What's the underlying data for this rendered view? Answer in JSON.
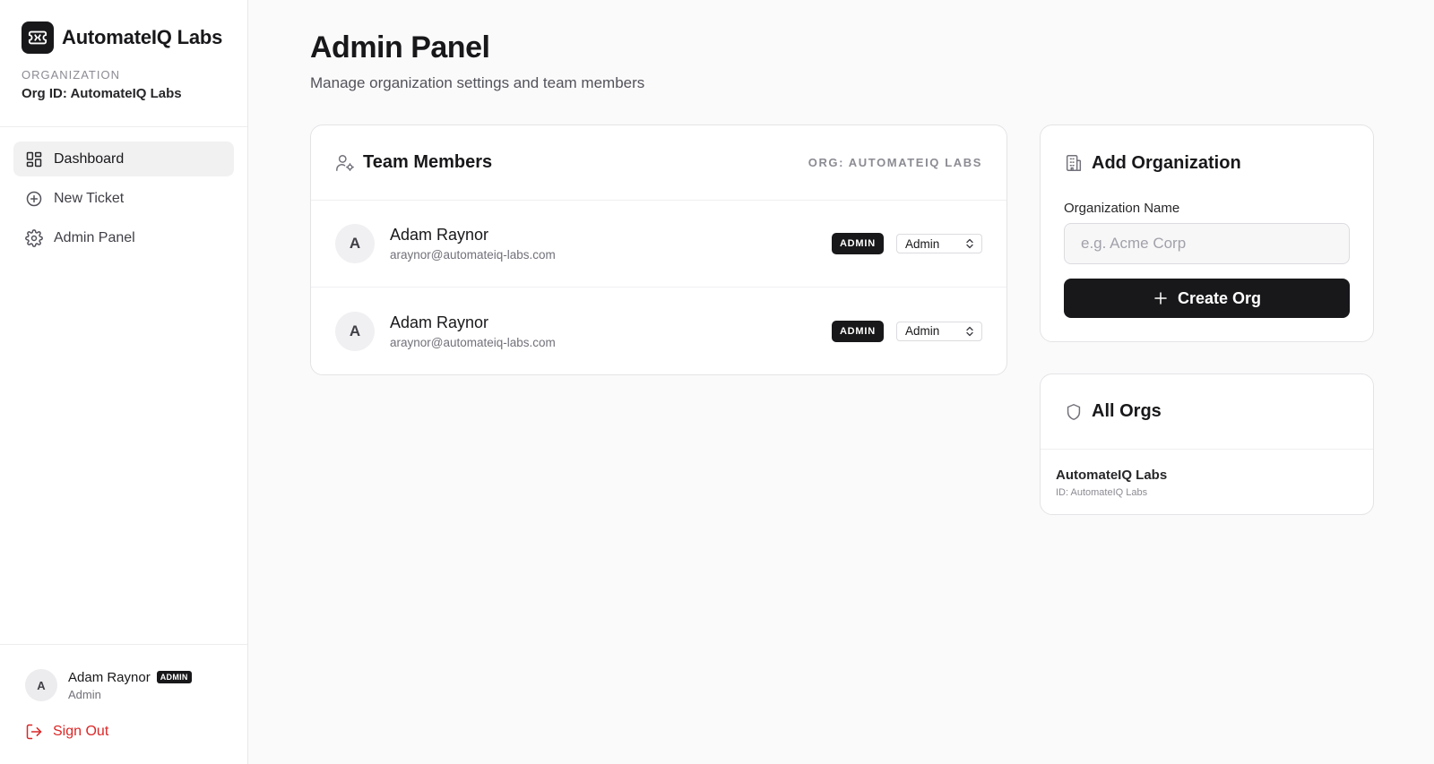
{
  "brand": {
    "name": "AutomateIQ Labs",
    "logo_icon": "ticket-icon"
  },
  "organization": {
    "label": "ORGANIZATION",
    "org_id": "Org ID: AutomateIQ Labs"
  },
  "nav": {
    "items": [
      {
        "label": "Dashboard",
        "icon": "dashboard-icon",
        "active": true
      },
      {
        "label": "New Ticket",
        "icon": "plus-circle-icon",
        "active": false
      },
      {
        "label": "Admin Panel",
        "icon": "gear-icon",
        "active": false
      }
    ]
  },
  "current_user": {
    "avatar_letter": "A",
    "name": "Adam Raynor",
    "badge": "ADMIN",
    "role": "Admin",
    "sign_out_label": "Sign Out"
  },
  "page": {
    "title": "Admin Panel",
    "subtitle": "Manage organization settings and team members"
  },
  "team": {
    "title": "Team Members",
    "org_tag": "ORG: AUTOMATEIQ LABS",
    "members": [
      {
        "avatar_letter": "A",
        "name": "Adam Raynor",
        "email": "araynor@automateiq-labs.com",
        "badge": "ADMIN",
        "role_value": "Admin"
      },
      {
        "avatar_letter": "A",
        "name": "Adam Raynor",
        "email": "araynor@automateiq-labs.com",
        "badge": "ADMIN",
        "role_value": "Admin"
      }
    ]
  },
  "add_org": {
    "title": "Add Organization",
    "field_label": "Organization Name",
    "placeholder": "e.g. Acme Corp",
    "button_label": "Create Org"
  },
  "all_orgs": {
    "title": "All Orgs",
    "items": [
      {
        "name": "AutomateIQ Labs",
        "id": "ID: AutomateIQ Labs"
      }
    ]
  },
  "colors": {
    "accent": "#18181b",
    "danger": "#dc2626",
    "background": "#fafafa"
  }
}
